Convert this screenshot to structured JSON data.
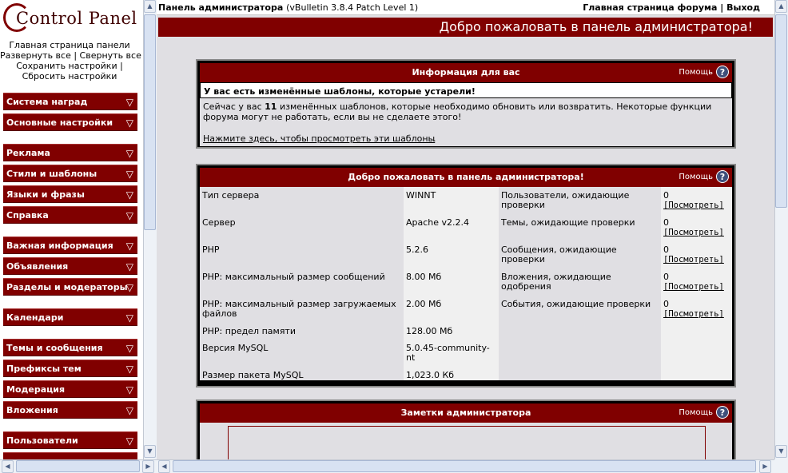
{
  "left": {
    "logo_text": "Control Panel",
    "links": [
      {
        "text": "Главная страница панели"
      },
      {
        "text": "Развернуть все | Свернуть все"
      },
      {
        "text": "Сохранить настройки |"
      },
      {
        "text": "Сбросить настройки"
      }
    ],
    "nav": [
      {
        "label": "Система наград"
      },
      {
        "label": "Основные настройки"
      },
      {
        "label": "Реклама"
      },
      {
        "label": "Стили и шаблоны"
      },
      {
        "label": "Языки и фразы"
      },
      {
        "label": "Справка"
      },
      {
        "label": "Важная информация"
      },
      {
        "label": "Объявления"
      },
      {
        "label": "Разделы и модераторы"
      },
      {
        "label": "Календари"
      },
      {
        "label": "Темы и сообщения"
      },
      {
        "label": "Префиксы тем"
      },
      {
        "label": "Модерация"
      },
      {
        "label": "Вложения"
      },
      {
        "label": "Пользователи"
      }
    ],
    "nav_arrow": "▽"
  },
  "topbar": {
    "title": "Панель администратора",
    "version": "(vBulletin 3.8.4 Patch Level 1)",
    "forum_link": "Главная страница форума",
    "separator": "|",
    "logout": "Выход"
  },
  "banner": "Добро пожаловать в панель администратора!",
  "help_label": "Помощь",
  "help_icon": "?",
  "info_box": {
    "title": "Информация для вас",
    "alert": "У вас есть изменённые шаблоны, которые устарели!",
    "message_pre": "Сейчас у вас ",
    "message_count": "11",
    "message_post": " изменённых шаблонов, которые необходимо обновить или возвратить. Некоторые функции форума могут не работать, если вы не сделаете этого!",
    "link": "Нажмите здесь, чтобы просмотреть эти шаблоны",
    "link_dot": "."
  },
  "welcome_box": {
    "title": "Добро пожаловать в панель администратора!",
    "server": [
      {
        "label": "Тип сервера",
        "value": "WINNT"
      },
      {
        "label": "Сервер",
        "value": "Apache v2.2.4"
      },
      {
        "label": "PHP",
        "value": "5.2.6"
      },
      {
        "label": "PHP: максимальный размер сообщений",
        "value": "8.00 Мб"
      },
      {
        "label": "PHP: максимальный размер загружаемых файлов",
        "value": "2.00 Мб"
      },
      {
        "label": "PHP: предел памяти",
        "value": "128.00 Мб"
      },
      {
        "label": "Версия MySQL",
        "value": "5.0.45-community-nt"
      },
      {
        "label": "Размер пакета MySQL",
        "value": "1,023.0 Кб"
      }
    ],
    "moderation": [
      {
        "label": "Пользователи, ожидающие проверки",
        "count": "0",
        "link": "[Посмотреть]"
      },
      {
        "label": "Темы, ожидающие проверки",
        "count": "0",
        "link": "[Посмотреть]"
      },
      {
        "label": "Сообщения, ожидающие проверки",
        "count": "0",
        "link": "[Посмотреть]"
      },
      {
        "label": "Вложения, ожидающие одобрения",
        "count": "0",
        "link": "[Посмотреть]"
      },
      {
        "label": "События, ожидающие проверки",
        "count": "0",
        "link": "[Посмотреть]"
      }
    ]
  },
  "notes_box": {
    "title": "Заметки администратора"
  },
  "scroll": {
    "up": "▲",
    "down": "▼",
    "left": "◀",
    "right": "▶"
  }
}
